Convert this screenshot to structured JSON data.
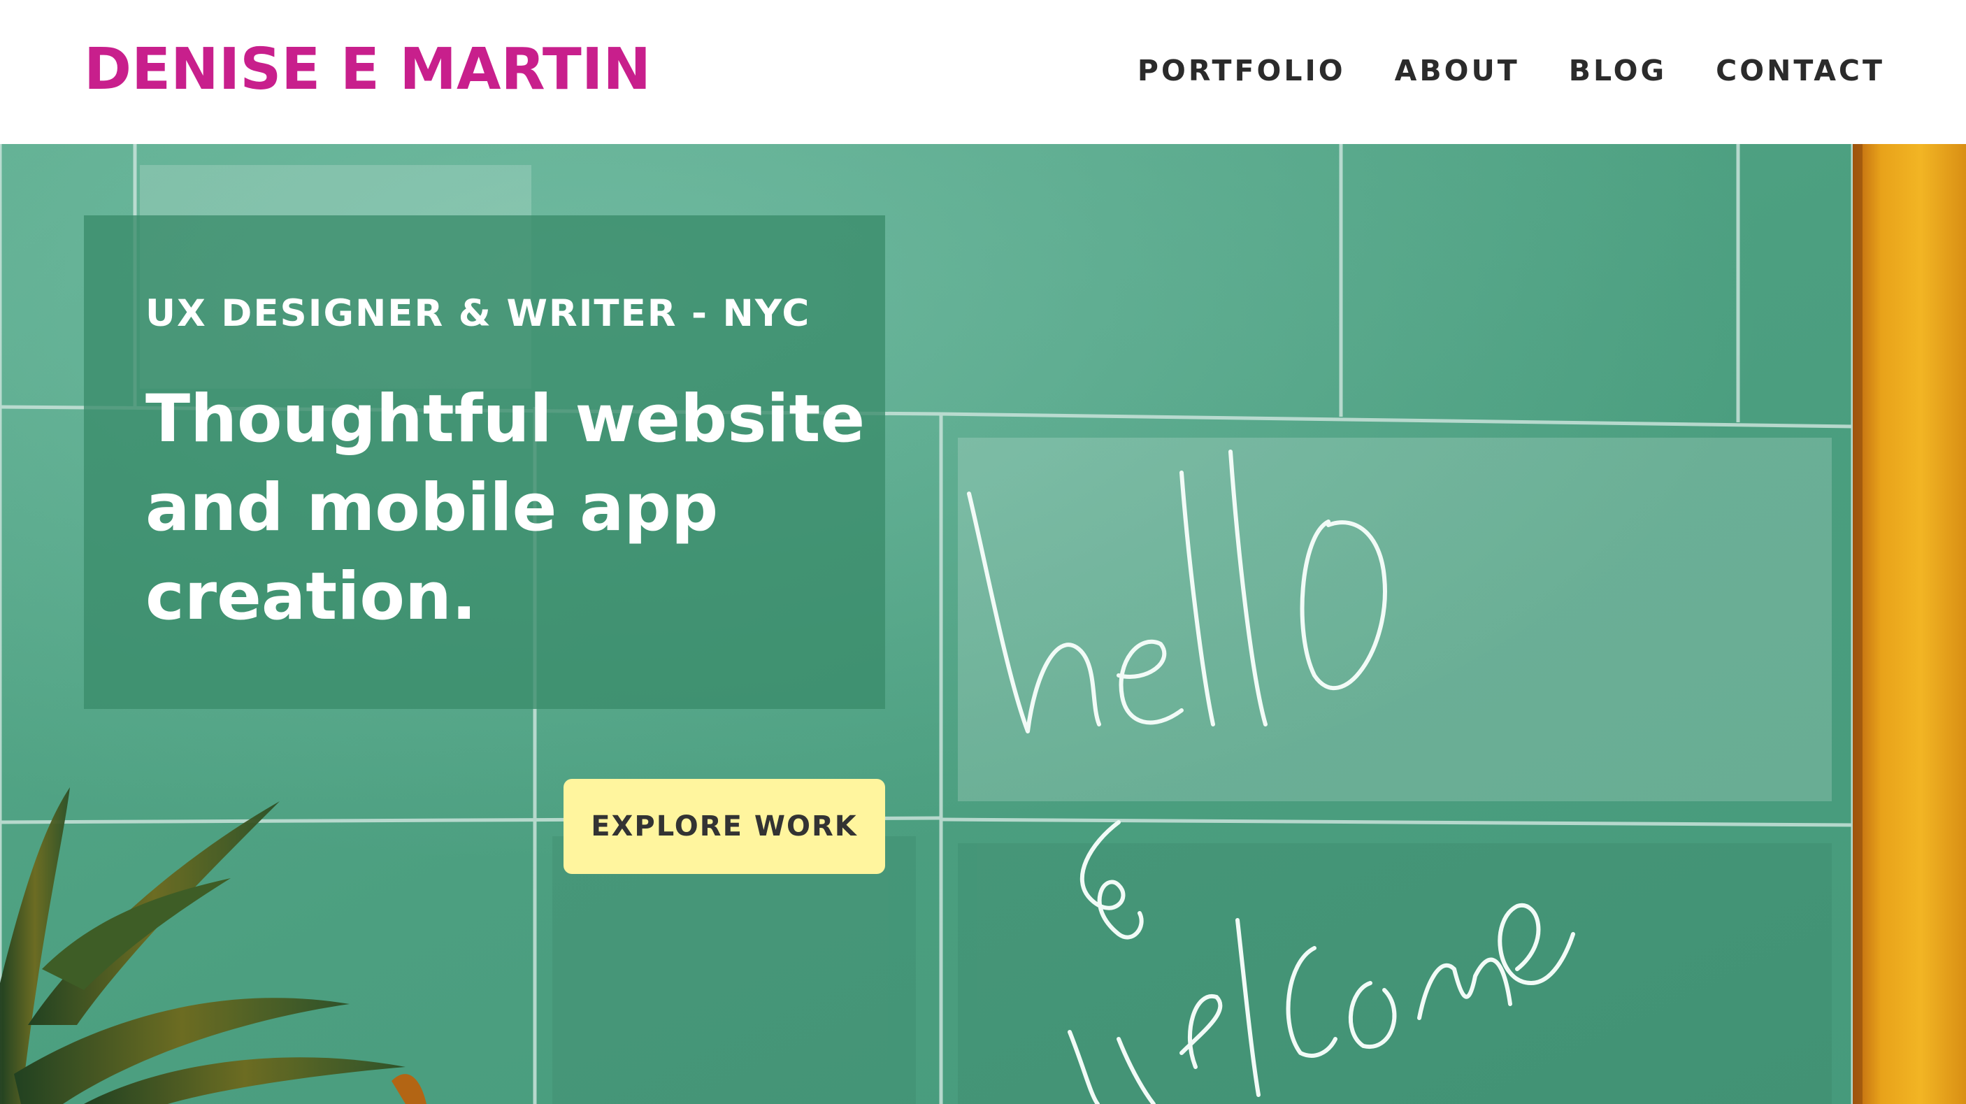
{
  "site": {
    "logo_text": "DENISE E MARTIN",
    "brand_color": "#c81f8c"
  },
  "nav": {
    "items": [
      {
        "label": "PORTFOLIO"
      },
      {
        "label": "ABOUT"
      },
      {
        "label": "BLOG"
      },
      {
        "label": "CONTACT"
      }
    ]
  },
  "hero": {
    "background_description_icon": "chalkboard-tile-wall-image",
    "chalk_words": [
      "hello",
      "&",
      "welcome"
    ],
    "eyebrow": "UX DESIGNER & WRITER - NYC",
    "headline": "Thoughtful website and mobile app creation.",
    "cta_label": "EXPLORE WORK",
    "cta_color": "#fff59e",
    "panel_color": "#3a8c6a"
  }
}
